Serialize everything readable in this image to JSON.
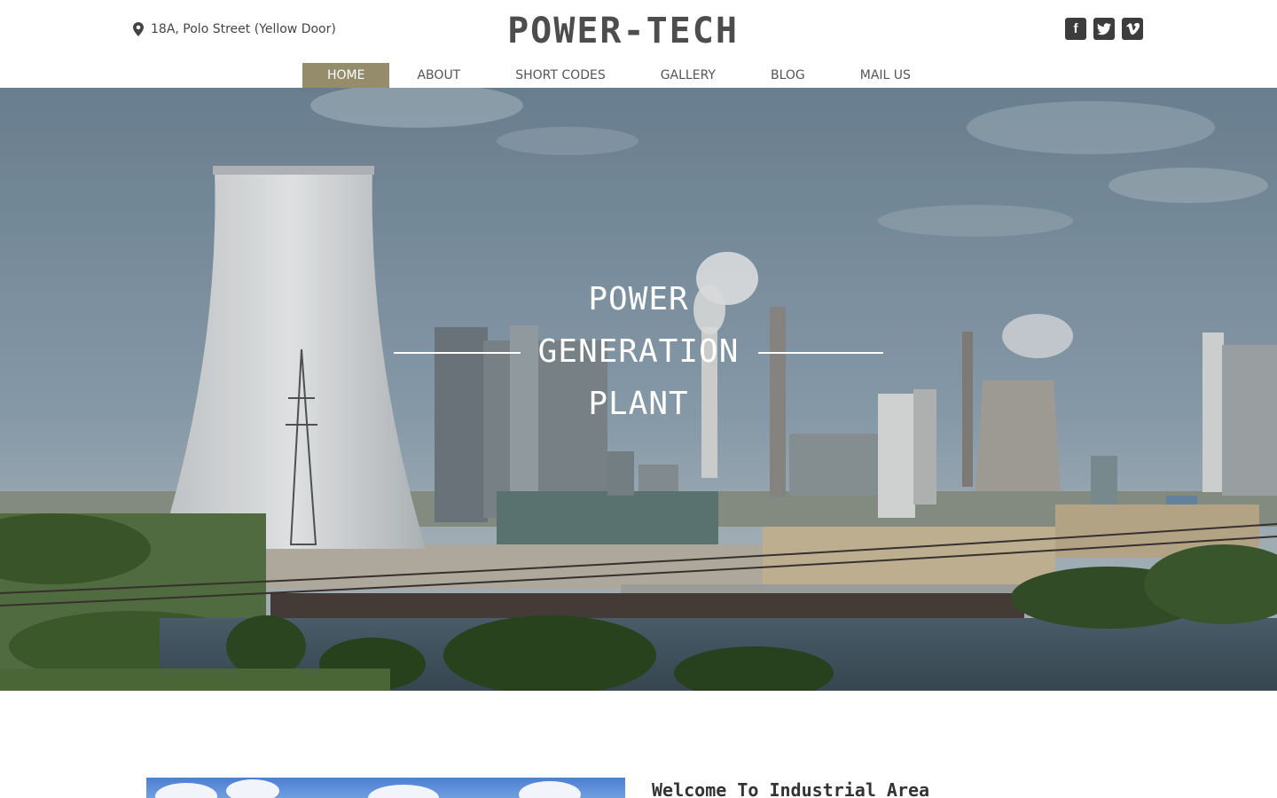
{
  "header": {
    "address": "18A, Polo Street (Yellow Door)",
    "address_icon": "map-pin-icon",
    "logo": "POWER-TECH",
    "social": [
      {
        "icon": "facebook-icon",
        "glyph": "f"
      },
      {
        "icon": "twitter-icon",
        "glyph": "t"
      },
      {
        "icon": "vimeo-icon",
        "glyph": "v"
      }
    ]
  },
  "nav": {
    "items": [
      "HOME",
      "ABOUT",
      "SHORT CODES",
      "GALLERY",
      "BLOG",
      "MAIL US"
    ],
    "active": "HOME",
    "active_color": "#948c6b"
  },
  "hero": {
    "lines": [
      "POWER",
      "GENERATION",
      "PLANT"
    ]
  },
  "content": {
    "welcome": "Welcome To Industrial Area"
  }
}
